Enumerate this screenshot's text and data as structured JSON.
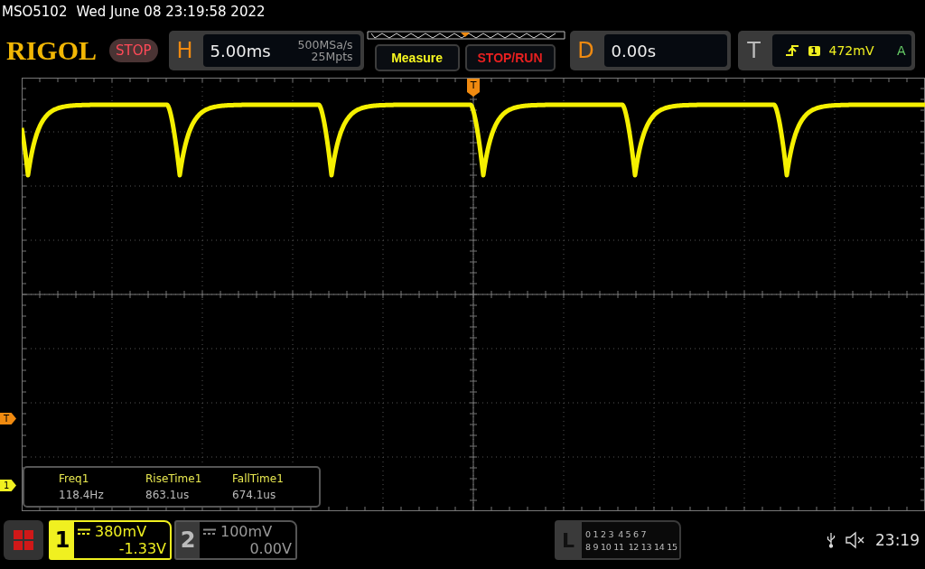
{
  "top_line": {
    "model": "MSO5102",
    "datetime": "Wed June 08 23:19:58 2022"
  },
  "header": {
    "logo": "RIGOL",
    "run_status": "STOP",
    "horizontal": {
      "label": "H",
      "timebase": "5.00ms",
      "sample_rate": "500MSa/s",
      "memory_depth": "25Mpts"
    },
    "buttons": [
      {
        "label": "Measure",
        "kind": "measure"
      },
      {
        "label": "STOP/RUN",
        "kind": "stoprun"
      }
    ],
    "delay": {
      "label": "D",
      "value": "0.00s"
    },
    "trigger": {
      "label": "T",
      "source": "1",
      "level": "472mV",
      "mode": "A"
    }
  },
  "screen": {
    "trigger_position_marker": "T",
    "markers": [
      {
        "kind": "trigger",
        "label": "T"
      },
      {
        "kind": "channel",
        "label": "1"
      }
    ],
    "measurements": [
      {
        "name": "Freq1",
        "value": "118.4Hz"
      },
      {
        "name": "RiseTime1",
        "value": "863.1us"
      },
      {
        "name": "FallTime1",
        "value": "674.1us"
      }
    ]
  },
  "channels": [
    {
      "number": "1",
      "scale": "380mV",
      "offset": "-1.33V",
      "active": true
    },
    {
      "number": "2",
      "scale": "100mV",
      "offset": "0.00V",
      "active": false
    }
  ],
  "logic": {
    "label": "L",
    "rows": [
      [
        "0 1 2 3",
        "4 5 6 7"
      ],
      [
        "8 9 10 11",
        "12 13 14 15"
      ]
    ]
  },
  "status_bar": {
    "time": "23:19"
  }
}
